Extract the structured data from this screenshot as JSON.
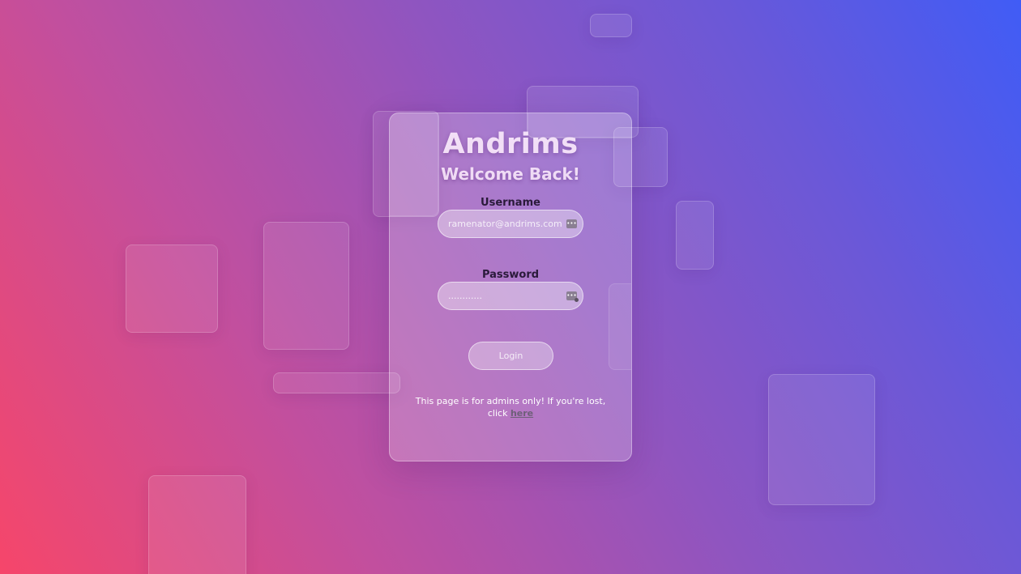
{
  "login": {
    "brand": "Andrims",
    "subtitle": "Welcome Back!",
    "username_label": "Username",
    "username_placeholder": "ramenator@andrims.com",
    "password_label": "Password",
    "password_value": "............",
    "login_button": "Login",
    "notice_text": "This page is for admins only! If you're lost, click",
    "notice_link": "here"
  },
  "icons": {
    "username_autofill": "password-manager-icon",
    "password_autofill": "password-manager-key-icon"
  },
  "colors": {
    "gradient_start": "#f6466a",
    "gradient_mid": "#8f55c0",
    "gradient_end": "#405cf6"
  }
}
